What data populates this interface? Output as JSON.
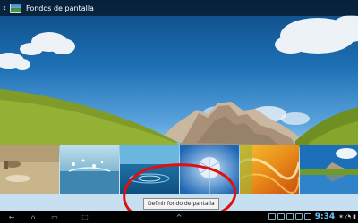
{
  "action_bar": {
    "title": "Fondos de pantalla",
    "back_icon": "chevron-left-icon",
    "app_icon": "wallpaper-app-icon"
  },
  "thumbnails": [
    {
      "name": "thumb-sand",
      "selected": false
    },
    {
      "name": "thumb-water-splash",
      "selected": false
    },
    {
      "name": "thumb-water-ripple",
      "selected": false
    },
    {
      "name": "thumb-dandelion",
      "selected": true
    },
    {
      "name": "thumb-orange-abstract",
      "selected": false
    },
    {
      "name": "thumb-mountain-lake",
      "selected": false
    }
  ],
  "tooltip": {
    "text": "Definir fondo de pantalla"
  },
  "system_bar": {
    "time": "9:34",
    "navigation": [
      "back-icon",
      "home-icon",
      "recent-apps-icon",
      "screenshot-icon"
    ],
    "up_arrow": "^"
  },
  "colors": {
    "sky_top": "#0d4a82",
    "selection": "#3aa9ff",
    "annotation_red": "#e01010",
    "clock": "#6fc6ff"
  }
}
